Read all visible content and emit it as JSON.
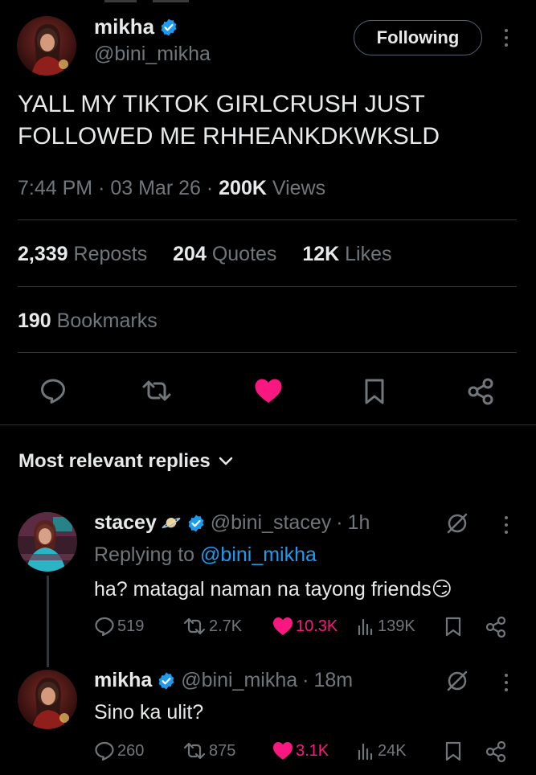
{
  "tweet": {
    "author_name": "mikha",
    "author_handle": "@bini_mikha",
    "follow_label": "Following",
    "text": "YALL MY TIKTOK GIRLCRUSH JUST FOLLOWED ME RHHEANKDKWKSLD",
    "time": "7:44 PM",
    "date": "03 Mar 26",
    "views_count": "200K",
    "views_label": "Views",
    "reposts_count": "2,339",
    "reposts_label": "Reposts",
    "quotes_count": "204",
    "quotes_label": "Quotes",
    "likes_count": "12K",
    "likes_label": "Likes",
    "bookmarks_count": "190",
    "bookmarks_label": "Bookmarks",
    "liked": true
  },
  "actions": [
    "reply-icon",
    "repost-icon",
    "like-icon",
    "bookmark-icon",
    "share-icon"
  ],
  "replies_header": "Most relevant replies",
  "replies": [
    {
      "name": "stacey",
      "name_emoji": "🪐",
      "handle": "@bini_stacey",
      "time": "1h",
      "replying_prefix": "Replying to",
      "replying_to": "@bini_mikha",
      "text": "ha? matagal naman na tayong friends😏",
      "replies": "519",
      "reposts": "2.7K",
      "likes": "10.3K",
      "views": "139K",
      "liked": true
    },
    {
      "name": "mikha",
      "handle": "@bini_mikha",
      "time": "18m",
      "text": "Sino ka ulit?",
      "replies": "260",
      "reposts": "875",
      "likes": "3.1K",
      "views": "24K",
      "liked": true
    }
  ],
  "colors": {
    "background": "#000000",
    "text": "#e7e9ea",
    "secondary": "#71767b",
    "like": "#f91880",
    "verified": "#1d9bf0",
    "link": "#1d9bf0",
    "divider": "#2f3336"
  }
}
